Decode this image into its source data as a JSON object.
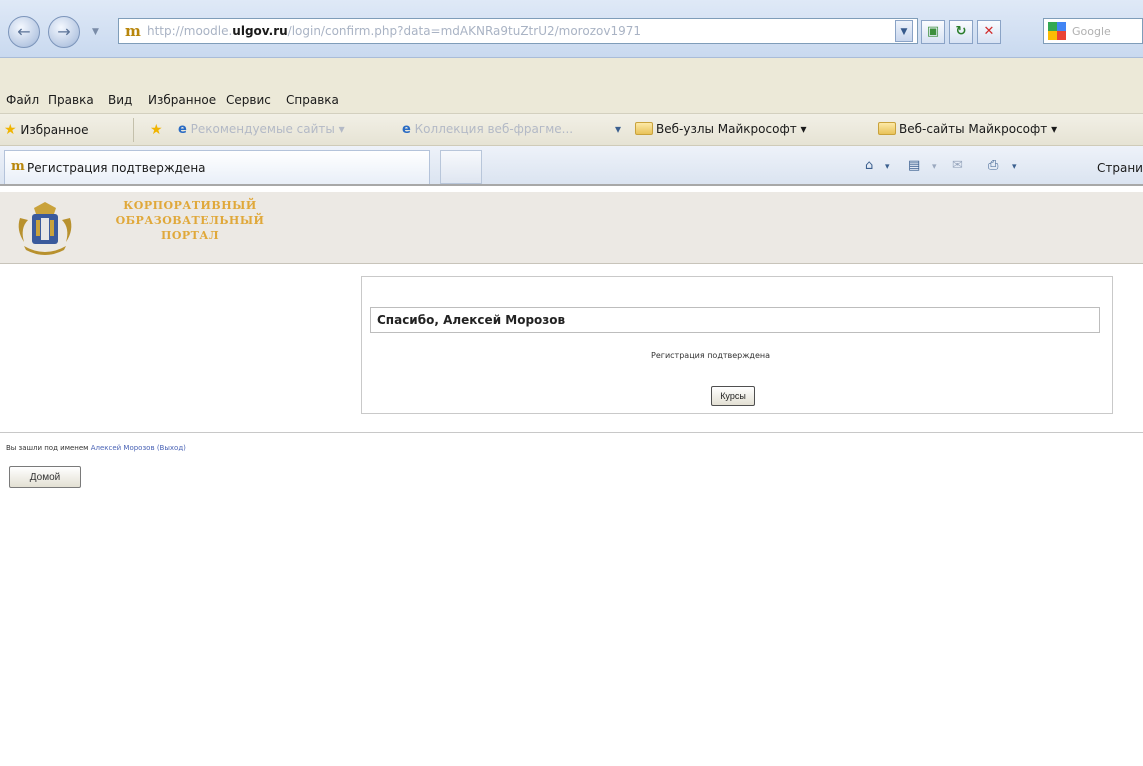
{
  "browser": {
    "url_host_prefix": "http://moodle.",
    "url_host_bold": "ulgov.ru",
    "url_path": "/login/confirm.php?data=mdAKNRa9tuZtrU2/morozov1971",
    "search_placeholder": "Google"
  },
  "menu": [
    "Файл",
    "Правка",
    "Вид",
    "Избранное",
    "Сервис",
    "Справка"
  ],
  "favorites": {
    "label": "Избранное",
    "items": [
      {
        "label": "Рекомендуемые сайты ▾",
        "dim": true
      },
      {
        "label": "Коллекция веб-фрагме...",
        "dim": true
      },
      {
        "label": "Веб-узлы Майкрософт ▾",
        "dim": false
      },
      {
        "label": "Веб-сайты Майкрософт ▾",
        "dim": false
      }
    ]
  },
  "tab": {
    "title": "Регистрация подтверждена"
  },
  "command_bar": {
    "page_label": "Страни"
  },
  "site": {
    "title_line1": "КОРПОРАТИВНЫЙ",
    "title_line2": "ОБРАЗОВАТЕЛЬНЫЙ",
    "title_line3": "ПОРТАЛ"
  },
  "content": {
    "thanks": "Спасибо, Алексей Морозов",
    "confirmation": "Регистрация подтверждена",
    "courses_button": "Курсы"
  },
  "footer": {
    "logged_in_prefix": "Вы зашли под именем",
    "user_name": "Алексей Морозов",
    "logout": "(Выход)",
    "home_button": "Домой"
  },
  "colors": {
    "portal_title": "#e0a83a",
    "link": "#4a63b5",
    "header_bg": "#ece9e4"
  }
}
